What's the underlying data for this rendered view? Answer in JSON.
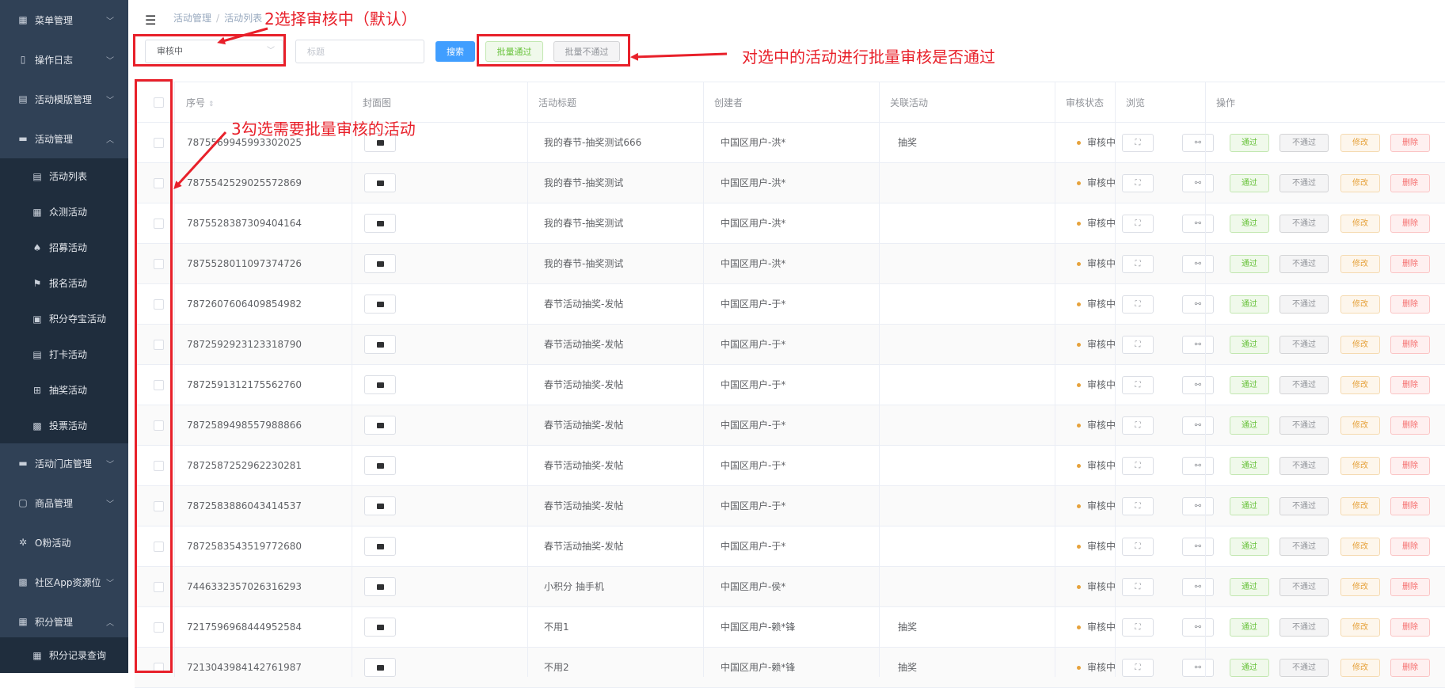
{
  "sidebar": {
    "items": [
      {
        "label": "菜单管理",
        "icon": "grid-icon",
        "arrow": "﹀"
      },
      {
        "label": "操作日志",
        "icon": "document-icon",
        "arrow": "﹀"
      },
      {
        "label": "活动模版管理",
        "icon": "template-icon",
        "arrow": "﹀"
      },
      {
        "label": "活动管理",
        "icon": "monitor-icon",
        "arrow": "︿"
      }
    ],
    "sub_items": [
      {
        "label": "活动列表",
        "icon": "list-icon"
      },
      {
        "label": "众测活动",
        "icon": "grid-icon"
      },
      {
        "label": "招募活动",
        "icon": "bell-icon"
      },
      {
        "label": "报名活动",
        "icon": "flag-icon"
      },
      {
        "label": "积分夺宝活动",
        "icon": "bag-icon"
      },
      {
        "label": "打卡活动",
        "icon": "clipboard-icon"
      },
      {
        "label": "抽奖活动",
        "icon": "gift-icon"
      },
      {
        "label": "投票活动",
        "icon": "vote-icon"
      }
    ],
    "items2": [
      {
        "label": "活动门店管理",
        "icon": "store-icon",
        "arrow": "﹀"
      },
      {
        "label": "商品管理",
        "icon": "bag-icon",
        "arrow": "﹀"
      },
      {
        "label": "O粉活动",
        "icon": "sparkle-icon",
        "arrow": ""
      },
      {
        "label": "社区App资源位",
        "icon": "image-icon",
        "arrow": "﹀"
      },
      {
        "label": "积分管理",
        "icon": "grid-icon",
        "arrow": "︿"
      }
    ],
    "sub_items2": [
      {
        "label": "积分记录查询",
        "icon": "grid-icon"
      }
    ]
  },
  "header": {
    "menu_icon": "hamburger-icon",
    "breadcrumb": [
      "活动管理",
      "活动列表"
    ]
  },
  "filters": {
    "status_value": "审核中",
    "title_placeholder": "标题",
    "search_label": "搜索",
    "batch_pass_label": "批量通过",
    "batch_fail_label": "批量不通过"
  },
  "table": {
    "headers": {
      "index": "序号",
      "cover": "封面图",
      "title": "活动标题",
      "creator": "创建者",
      "related": "关联活动",
      "status": "审核状态",
      "browse": "浏览",
      "ops": "操作"
    },
    "rows": [
      {
        "id": "7875569945993302025",
        "title": "我的春节-抽奖测试666",
        "creator": "中国区用户-洪*",
        "related": "抽奖",
        "status": "审核中"
      },
      {
        "id": "7875542529025572869",
        "title": "我的春节-抽奖测试",
        "creator": "中国区用户-洪*",
        "related": "",
        "status": "审核中"
      },
      {
        "id": "7875528387309404164",
        "title": "我的春节-抽奖测试",
        "creator": "中国区用户-洪*",
        "related": "",
        "status": "审核中"
      },
      {
        "id": "7875528011097374726",
        "title": "我的春节-抽奖测试",
        "creator": "中国区用户-洪*",
        "related": "",
        "status": "审核中"
      },
      {
        "id": "7872607606409854982",
        "title": "春节活动抽奖-发帖",
        "creator": "中国区用户-于*",
        "related": "",
        "status": "审核中"
      },
      {
        "id": "7872592923123318790",
        "title": "春节活动抽奖-发帖",
        "creator": "中国区用户-于*",
        "related": "",
        "status": "审核中"
      },
      {
        "id": "7872591312175562760",
        "title": "春节活动抽奖-发帖",
        "creator": "中国区用户-于*",
        "related": "",
        "status": "审核中"
      },
      {
        "id": "7872589498557988866",
        "title": "春节活动抽奖-发帖",
        "creator": "中国区用户-于*",
        "related": "",
        "status": "审核中"
      },
      {
        "id": "7872587252962230281",
        "title": "春节活动抽奖-发帖",
        "creator": "中国区用户-于*",
        "related": "",
        "status": "审核中"
      },
      {
        "id": "7872583886043414537",
        "title": "春节活动抽奖-发帖",
        "creator": "中国区用户-于*",
        "related": "",
        "status": "审核中"
      },
      {
        "id": "7872583543519772680",
        "title": "春节活动抽奖-发帖",
        "creator": "中国区用户-于*",
        "related": "",
        "status": "审核中"
      },
      {
        "id": "7446332357026316293",
        "title": "小积分 抽手机",
        "creator": "中国区用户-侯*",
        "related": "",
        "status": "审核中"
      },
      {
        "id": "7217596968444952584",
        "title": "不用1",
        "creator": "中国区用户-赖*锋",
        "related": "抽奖",
        "status": "审核中"
      },
      {
        "id": "7213043984142761987",
        "title": "不用2",
        "creator": "中国区用户-赖*锋",
        "related": "抽奖",
        "status": "审核中"
      }
    ],
    "actions": {
      "pass": "通过",
      "fail": "不通过",
      "edit": "修改",
      "delete": "删除"
    },
    "browse_icons": [
      "fullscreen-icon",
      "link-icon"
    ]
  },
  "annotations": {
    "step2": "2选择审核中（默认）",
    "step3": "3勾选需要批量审核的活动",
    "batch_note": "对选中的活动进行批量审核是否通过",
    "color": "#e8202a"
  }
}
